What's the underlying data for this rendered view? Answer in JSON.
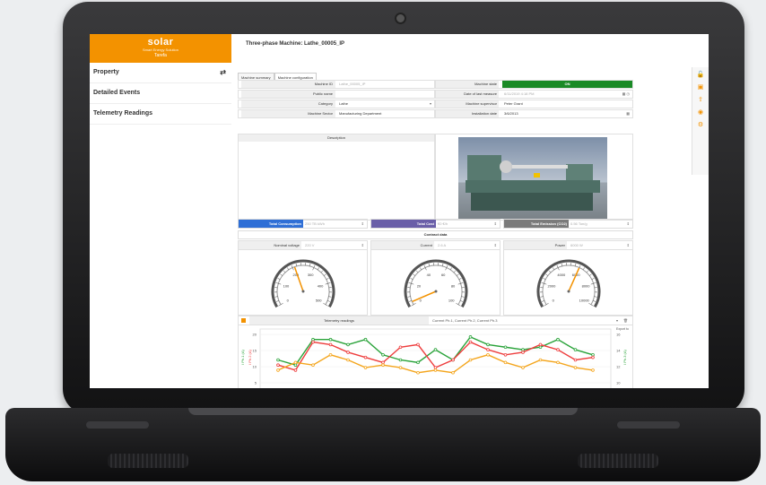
{
  "app": {
    "logo": "solar",
    "logo_tagline": "Smart Energy Solution",
    "tenant": "Tarefa"
  },
  "sidebar": {
    "items": [
      {
        "label": "Property",
        "icon": "swap-icon"
      },
      {
        "label": "Detailed Events"
      },
      {
        "label": "Telemetry Readings"
      }
    ]
  },
  "page": {
    "title": "Three-phase Machine: Lathe_00005_IP",
    "tabs": [
      "Machine summary",
      "Machine configuration"
    ]
  },
  "form": {
    "machine_id": {
      "label": "Machine ID",
      "value": "Lathe_00005_IP"
    },
    "public_name": {
      "label": "Public name",
      "value": ""
    },
    "category": {
      "label": "Category",
      "value": "Lathe"
    },
    "machine_sector": {
      "label": "Machine Sector",
      "value": "Manufacturing Department"
    },
    "machine_state": {
      "label": "Machine state",
      "value": "ON"
    },
    "last_measure": {
      "label": "Date of last measure",
      "value": "6/11/2019 4:18 PM"
    },
    "supervisor": {
      "label": "Machine supervisor",
      "value": "Peter Grant"
    },
    "installation_date": {
      "label": "Installation date",
      "value": "3/6/2013"
    },
    "description_label": "Description"
  },
  "kpis": [
    {
      "label": "Total Consumption",
      "value": "250 TB kWh",
      "color": "#2f6fd6"
    },
    {
      "label": "Total Cost",
      "value": "€0 €/h",
      "color": "#6a5fa8"
    },
    {
      "label": "Total Emission (CO2)",
      "value": "0.56 Ton/g",
      "color": "#7b7b7b"
    }
  ],
  "contract_title": "Contract data",
  "gauges": [
    {
      "label": "Nominal voltage",
      "value": "220 V",
      "ticks": [
        "0",
        "100",
        "200",
        "300",
        "400",
        "500"
      ],
      "needle_fraction": 0.42,
      "needle_color": "#f39200"
    },
    {
      "label": "Current",
      "value": "2.6 A",
      "ticks": [
        "0",
        "20",
        "40",
        "60",
        "80",
        "100"
      ],
      "needle_fraction": 0.03,
      "needle_color": "#f39200"
    },
    {
      "label": "Power",
      "value": "6000 W",
      "ticks": [
        "0",
        "2000",
        "4000",
        "6000",
        "8000",
        "10000"
      ],
      "needle_fraction": 0.6,
      "needle_color": "#f39200"
    }
  ],
  "chart": {
    "label": "Telemetry readings",
    "series_select": "Current Ph.1, Current Ph.2, Current Ph.3",
    "export": "Export to",
    "left_axis_label": "I Ph.1 (A)",
    "left_axis2_label": "I Ph.2 (A)",
    "right_axis_label": "I Ph.3 (A)"
  },
  "chart_data": {
    "type": "line",
    "y_ticks_left": [
      "20",
      "15",
      "10",
      "5"
    ],
    "y_ticks_right": [
      "16",
      "14",
      "12",
      "10"
    ],
    "series": [
      {
        "color": "#2aa33a",
        "values": [
          10,
          8,
          18,
          18,
          16,
          18,
          12,
          10,
          9,
          14,
          10,
          19,
          16,
          15,
          14,
          15,
          18,
          14,
          12
        ]
      },
      {
        "color": "#ee3d3d",
        "values": [
          8,
          6,
          17,
          16,
          13,
          11,
          9,
          15,
          16,
          7,
          10,
          17,
          14,
          12,
          13,
          16,
          14,
          10,
          11
        ]
      },
      {
        "color": "#f4a51c",
        "values": [
          6,
          9,
          8,
          12,
          10,
          7,
          8,
          7,
          5,
          6,
          5,
          10,
          12,
          9,
          7,
          10,
          9,
          7,
          6
        ]
      }
    ]
  },
  "colors": {
    "accent": "#f39200",
    "status_on": "#1a8a26"
  }
}
